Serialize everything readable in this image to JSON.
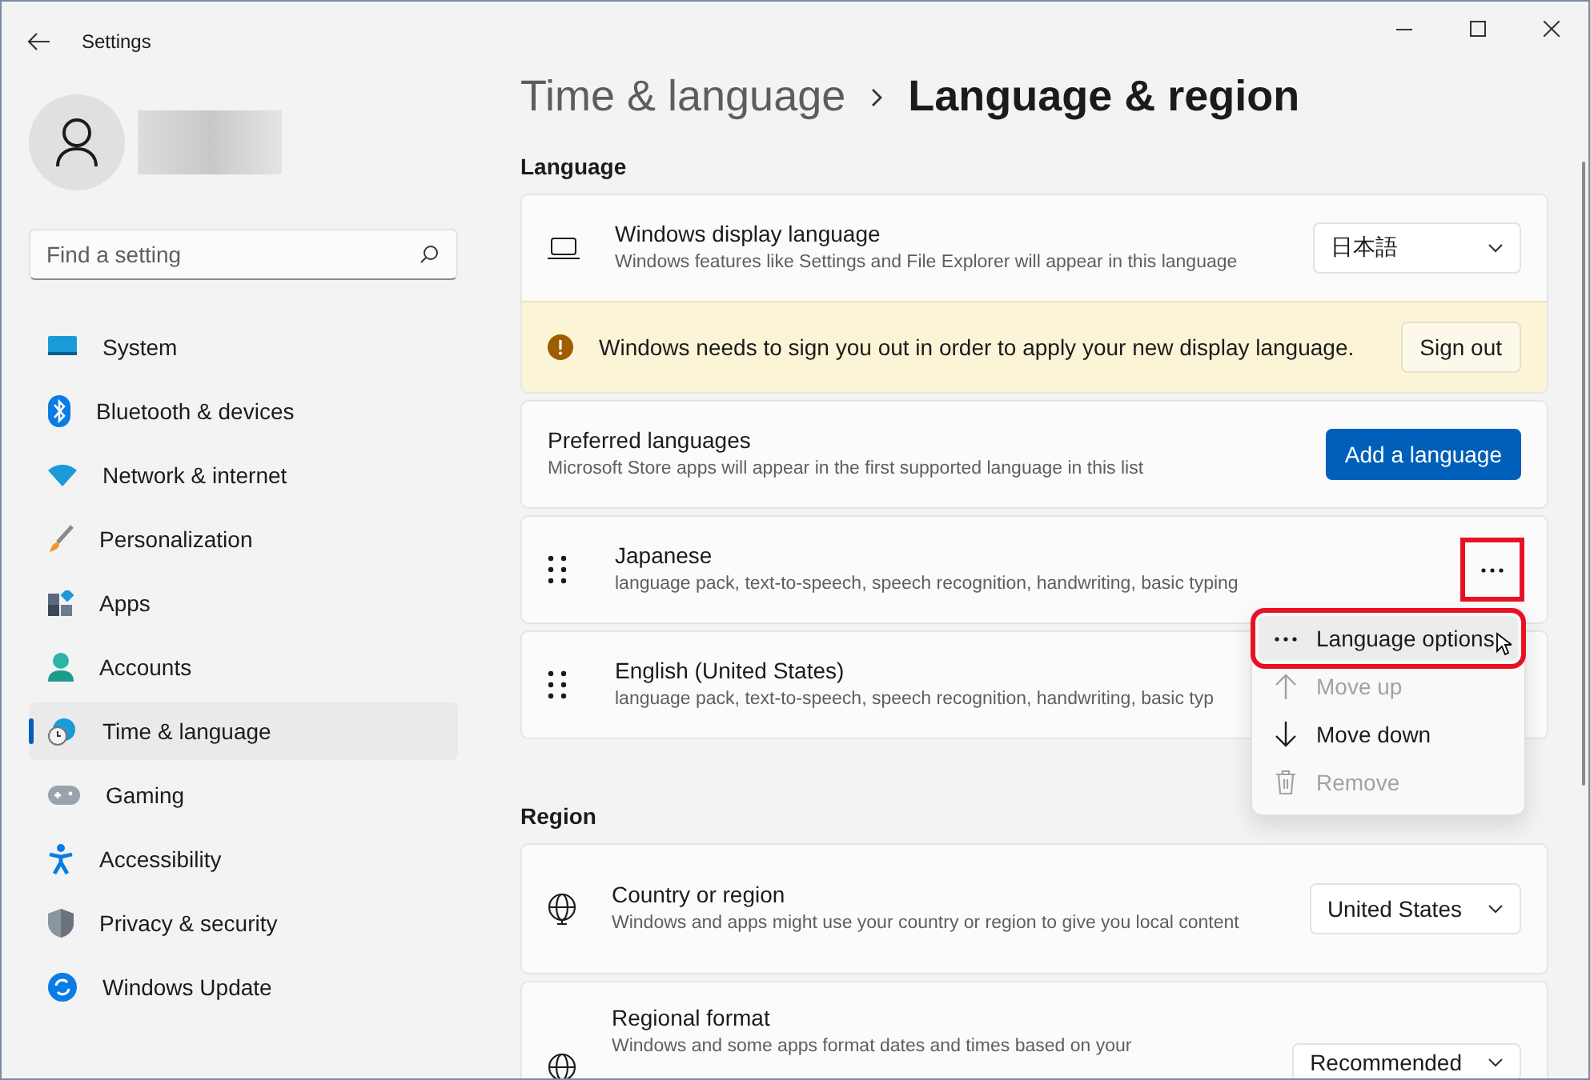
{
  "window": {
    "title": "Settings"
  },
  "search": {
    "placeholder": "Find a setting"
  },
  "nav": [
    {
      "label": "System",
      "selected": false
    },
    {
      "label": "Bluetooth & devices",
      "selected": false
    },
    {
      "label": "Network & internet",
      "selected": false
    },
    {
      "label": "Personalization",
      "selected": false
    },
    {
      "label": "Apps",
      "selected": false
    },
    {
      "label": "Accounts",
      "selected": false
    },
    {
      "label": "Time & language",
      "selected": true
    },
    {
      "label": "Gaming",
      "selected": false
    },
    {
      "label": "Accessibility",
      "selected": false
    },
    {
      "label": "Privacy & security",
      "selected": false
    },
    {
      "label": "Windows Update",
      "selected": false
    }
  ],
  "breadcrumb": {
    "parent": "Time & language",
    "current": "Language & region"
  },
  "language": {
    "heading": "Language",
    "display_language": {
      "title": "Windows display language",
      "description": "Windows features like Settings and File Explorer will appear in this language",
      "value": "日本語"
    },
    "notice": {
      "text": "Windows needs to sign you out in order to apply your new display language.",
      "button": "Sign out"
    },
    "preferred": {
      "title": "Preferred languages",
      "description": "Microsoft Store apps will appear in the first supported language in this list",
      "button": "Add a language"
    },
    "languages": [
      {
        "name": "Japanese",
        "description": "language pack, text-to-speech, speech recognition, handwriting, basic typing"
      },
      {
        "name": "English (United States)",
        "description": "language pack, text-to-speech, speech recognition, handwriting, basic typ"
      }
    ],
    "more_button": {
      "annotated": true
    }
  },
  "menu": {
    "items": [
      {
        "kind": "options",
        "label": "Language options",
        "disabled": false,
        "hovered": true,
        "annotated": true
      },
      {
        "kind": "up",
        "label": "Move up",
        "disabled": true,
        "hovered": false,
        "annotated": false
      },
      {
        "kind": "down",
        "label": "Move down",
        "disabled": false,
        "hovered": false,
        "annotated": false
      },
      {
        "kind": "remove",
        "label": "Remove",
        "disabled": true,
        "hovered": false,
        "annotated": false
      }
    ]
  },
  "region": {
    "heading": "Region",
    "rows": [
      {
        "title": "Country or region",
        "description": "Windows and apps might use your country or region to give you local content",
        "value": "United States"
      },
      {
        "title": "Regional format",
        "description": "Windows and some apps format dates and times based on your",
        "value": "Recommended"
      }
    ]
  }
}
